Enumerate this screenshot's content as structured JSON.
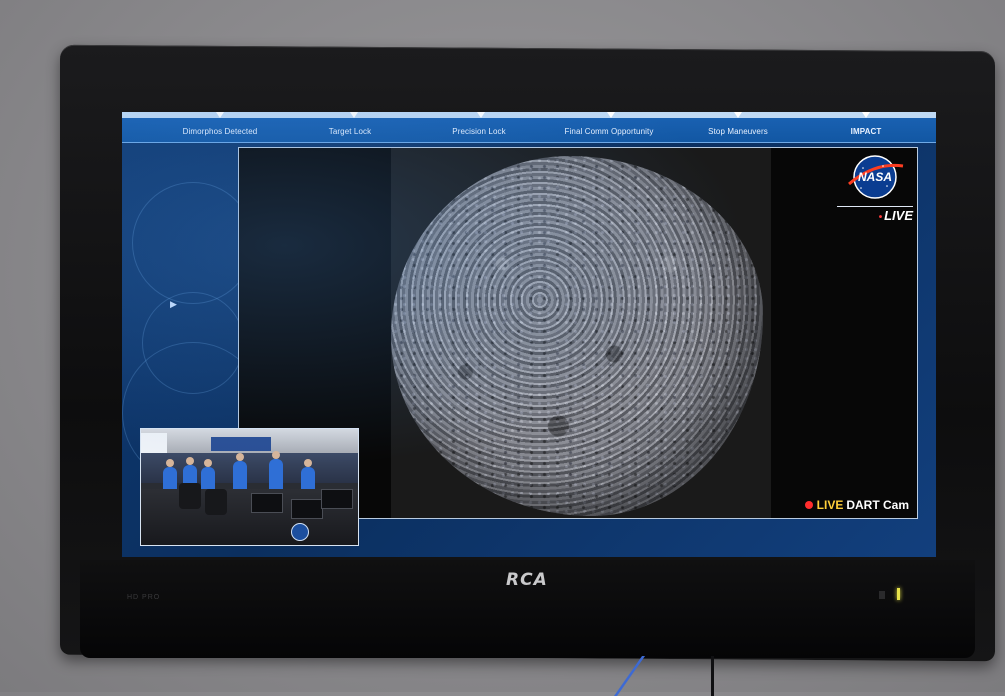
{
  "tv": {
    "brand": "RCA",
    "model_text": "HD PRO",
    "colors": {
      "bezel": "#0f0f10",
      "wall": "#8e8d90",
      "power_led": "#e6e24a"
    }
  },
  "broadcast": {
    "timeline": {
      "milestones": [
        "Dimorphos Detected",
        "Target Lock",
        "Precision Lock",
        "Final Comm Opportunity",
        "Stop Maneuvers",
        "IMPACT"
      ]
    },
    "logo_icon": "nasa-meatball-icon",
    "logo_text": "NASA",
    "live_tag": "LIVE",
    "feed_label_live": "LIVE",
    "feed_label_name": "DART Cam",
    "colors": {
      "accent_blue": "#1257a3",
      "live_red": "#ff2d2d",
      "live_yellow": "#ffcf3a"
    }
  }
}
